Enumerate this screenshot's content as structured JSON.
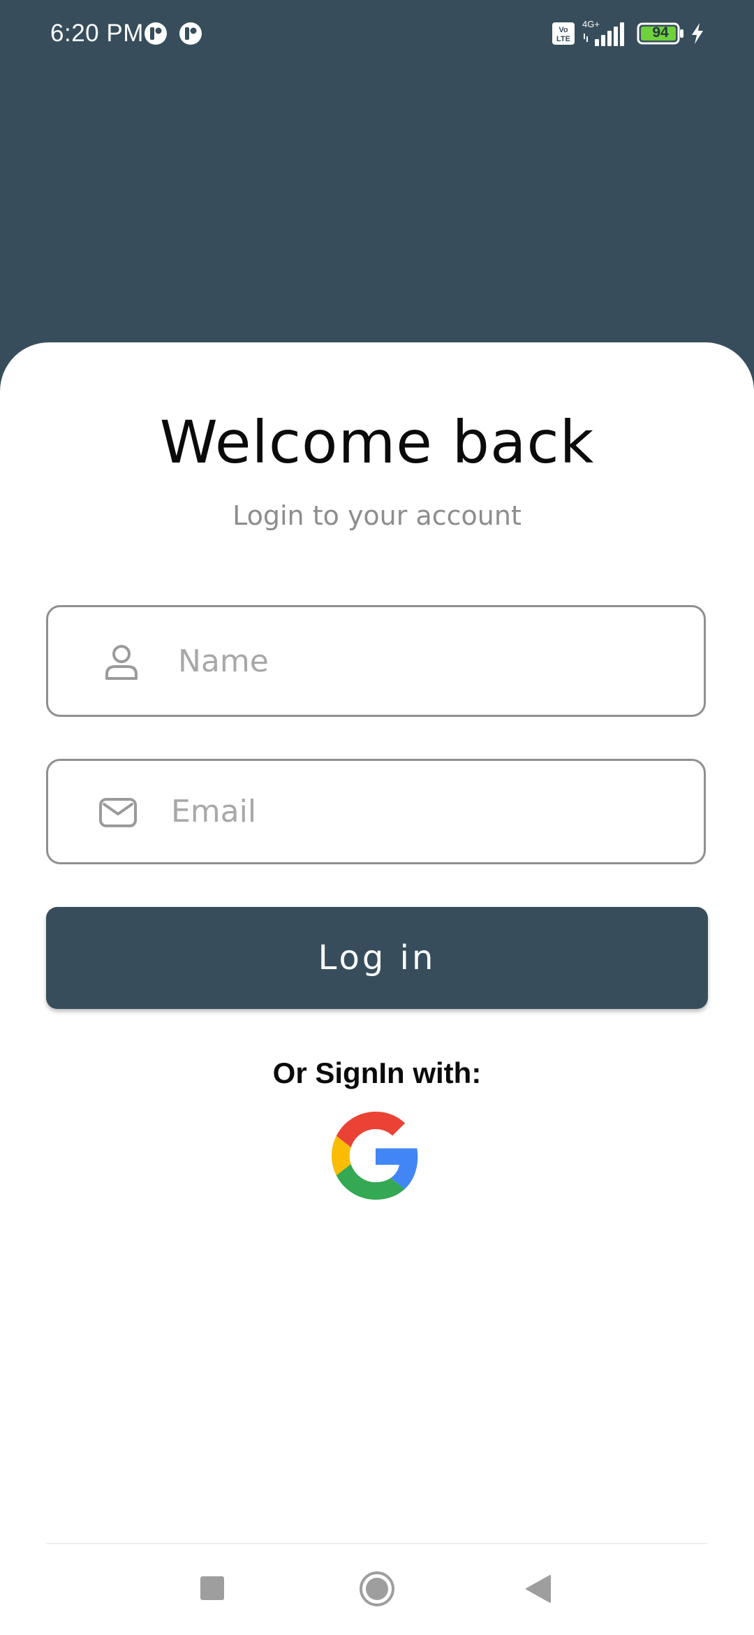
{
  "status_bar": {
    "time": "6:20 PM",
    "battery_level": "94",
    "network": "4G+",
    "volte_label": "Vo LTE"
  },
  "login": {
    "title": "Welcome back",
    "subtitle": "Login to your account",
    "name_field": {
      "placeholder": "Name",
      "value": "",
      "icon": "person-icon"
    },
    "email_field": {
      "placeholder": "Email",
      "value": "",
      "icon": "envelope-icon"
    },
    "login_button_label": "Log in",
    "social_prompt": "Or SignIn with:",
    "social_providers": [
      "google"
    ]
  },
  "nav_bar": {
    "buttons": [
      "recents",
      "home",
      "back"
    ]
  },
  "colors": {
    "primary": "#374d5b",
    "card_background": "#ffffff",
    "placeholder": "#a8a8a8",
    "field_border": "#8f8f8f",
    "battery_fill": "#6fd13b"
  }
}
